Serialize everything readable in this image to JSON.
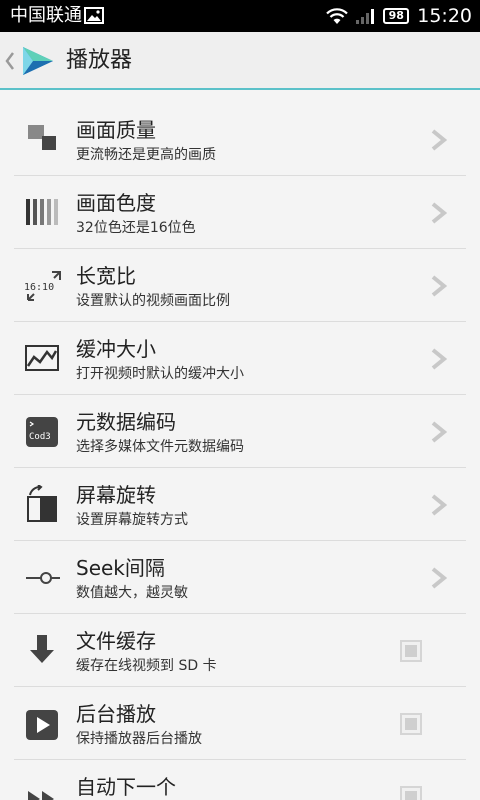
{
  "status_bar": {
    "carrier": "中国联通",
    "battery": "98",
    "time": "15:20"
  },
  "header": {
    "title": "播放器"
  },
  "settings": [
    {
      "title": "画面质量",
      "subtitle": "更流畅还是更高的画质",
      "icon": "quality-icon",
      "control": "chevron"
    },
    {
      "title": "画面色度",
      "subtitle": "32位色还是16位色",
      "icon": "color-depth-icon",
      "control": "chevron"
    },
    {
      "title": "长宽比",
      "subtitle": "设置默认的视频画面比例",
      "icon": "aspect-ratio-icon",
      "icon_text": "16:10",
      "control": "chevron"
    },
    {
      "title": "缓冲大小",
      "subtitle": "打开视频时默认的缓冲大小",
      "icon": "buffer-chart-icon",
      "control": "chevron"
    },
    {
      "title": "元数据编码",
      "subtitle": "选择多媒体文件元数据编码",
      "icon": "code-icon",
      "icon_text": "Cod3",
      "control": "chevron"
    },
    {
      "title": "屏幕旋转",
      "subtitle": "设置屏幕旋转方式",
      "icon": "rotate-icon",
      "control": "chevron"
    },
    {
      "title": "Seek间隔",
      "subtitle": "数值越大，越灵敏",
      "icon": "slider-icon",
      "control": "chevron"
    },
    {
      "title": "文件缓存",
      "subtitle": "缓存在线视频到 SD 卡",
      "icon": "download-icon",
      "control": "checkbox",
      "checked": false
    },
    {
      "title": "后台播放",
      "subtitle": "保持播放器后台播放",
      "icon": "play-icon",
      "control": "checkbox",
      "checked": false
    },
    {
      "title": "自动下一个",
      "subtitle": "",
      "icon": "next-icon",
      "control": "checkbox",
      "checked": false
    }
  ],
  "colors": {
    "accent": "#5bc1c9",
    "icon": "#444444",
    "chevron": "#c8c8c8"
  }
}
